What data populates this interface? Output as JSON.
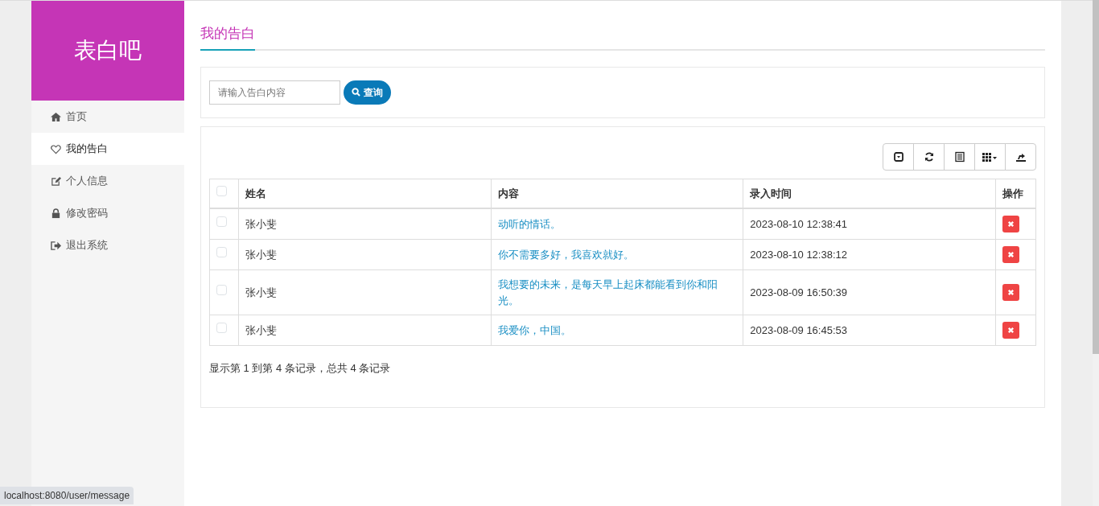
{
  "brand": "表白吧",
  "sidebar": {
    "items": [
      {
        "label": "首页",
        "selected": false
      },
      {
        "label": "我的告白",
        "selected": true
      },
      {
        "label": "个人信息",
        "selected": false
      },
      {
        "label": "修改密码",
        "selected": false
      },
      {
        "label": "退出系统",
        "selected": false
      }
    ]
  },
  "page_title": "我的告白",
  "search": {
    "placeholder": "请输入告白内容",
    "button": "查询"
  },
  "table": {
    "columns": [
      "姓名",
      "内容",
      "录入时间",
      "操作"
    ],
    "all_checked": false,
    "rows": [
      {
        "checked": false,
        "name": "张小斐",
        "content": "动听的情话。",
        "time": "2023-08-10 12:38:41"
      },
      {
        "checked": false,
        "name": "张小斐",
        "content": "你不需要多好，我喜欢就好。",
        "time": "2023-08-10 12:38:12"
      },
      {
        "checked": false,
        "name": "张小斐",
        "content": "我想要的未来，是每天早上起床都能看到你和阳光。",
        "time": "2023-08-09 16:50:39"
      },
      {
        "checked": false,
        "name": "张小斐",
        "content": "我爱你，中国。",
        "time": "2023-08-09 16:45:53"
      }
    ]
  },
  "pagination_info": "显示第 1 到第 4 条记录，总共 4 条记录",
  "status_bar": "localhost:8080/user/message"
}
